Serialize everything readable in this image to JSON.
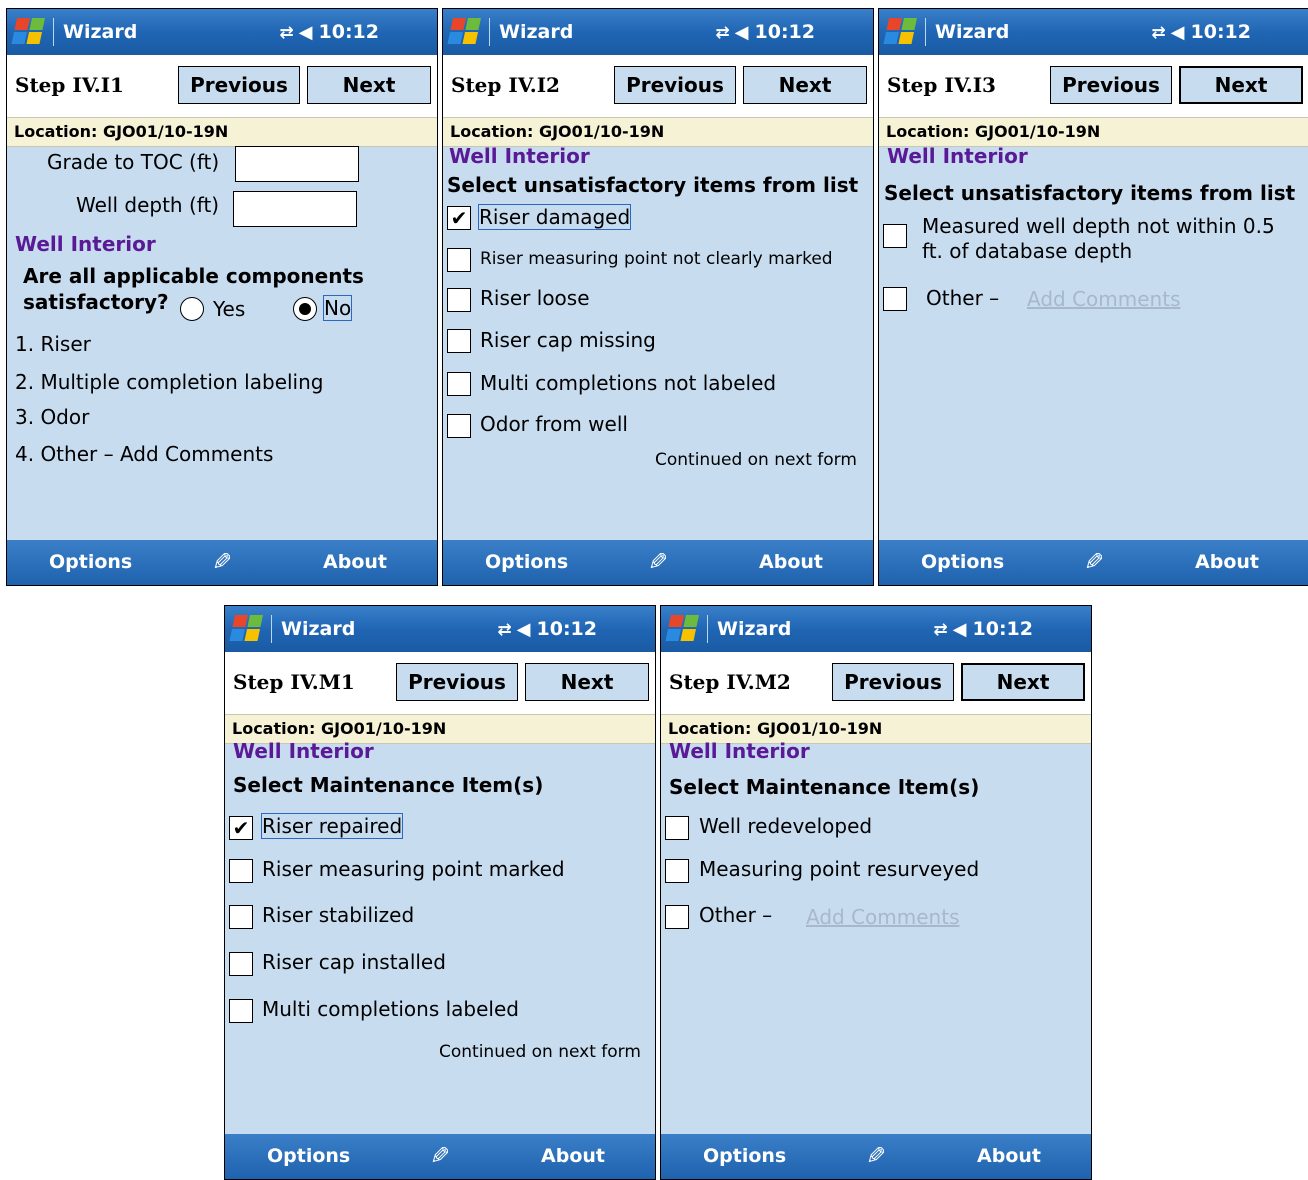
{
  "common": {
    "app_title": "Wizard",
    "time": "10:12",
    "connection_icon": "connectivity-arrows-icon",
    "speaker_icon": "speaker-icon",
    "previous_label": "Previous",
    "next_label": "Next",
    "location": "Location: GJO01/10-19N",
    "options_label": "Options",
    "about_label": "About",
    "section": "Well Interior"
  },
  "screens": [
    {
      "step": "Step IV.I1",
      "grade_label": "Grade to TOC (ft)",
      "grade_value": "",
      "depth_label": "Well depth (ft)",
      "depth_value": "",
      "question_line1": "Are all applicable components",
      "question_line2": "satisfactory?",
      "yes_label": "Yes",
      "no_label": "No",
      "selected": "No",
      "items": [
        "1. Riser",
        "2. Multiple completion labeling",
        "3. Odor",
        "4. Other – Add Comments"
      ]
    },
    {
      "step": "Step IV.I2",
      "instruction": "Select unsatisfactory items from list",
      "items": [
        {
          "label": "Riser damaged",
          "checked": true
        },
        {
          "label": "Riser measuring point not clearly marked",
          "checked": false
        },
        {
          "label": "Riser loose",
          "checked": false
        },
        {
          "label": "Riser cap missing",
          "checked": false
        },
        {
          "label": "Multi completions not labeled",
          "checked": false
        },
        {
          "label": "Odor from well",
          "checked": false
        }
      ],
      "continued": "Continued on next form"
    },
    {
      "step": "Step IV.I3",
      "instruction": "Select unsatisfactory items from list",
      "item1_line1": "Measured well depth not within 0.5",
      "item1_line2": "ft. of database depth",
      "other_label": "Other –",
      "add_comments": "Add Comments"
    },
    {
      "step": "Step IV.M1",
      "instruction": "Select Maintenance Item(s)",
      "items": [
        {
          "label": "Riser repaired",
          "checked": true
        },
        {
          "label": "Riser measuring point marked",
          "checked": false
        },
        {
          "label": "Riser stabilized",
          "checked": false
        },
        {
          "label": "Riser cap installed",
          "checked": false
        },
        {
          "label": "Multi completions labeled",
          "checked": false
        }
      ],
      "continued": "Continued on next form"
    },
    {
      "step": "Step IV.M2",
      "instruction": "Select Maintenance Item(s)",
      "items": [
        {
          "label": "Well redeveloped",
          "checked": false
        },
        {
          "label": "Measuring point resurveyed",
          "checked": false
        }
      ],
      "other_label": "Other –",
      "add_comments": "Add Comments"
    }
  ]
}
